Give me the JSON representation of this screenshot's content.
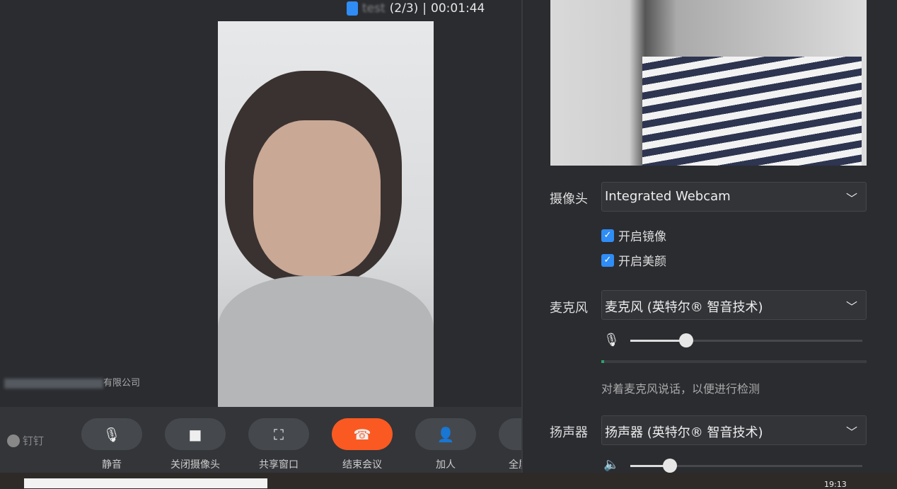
{
  "meeting": {
    "title_blurred": "test",
    "count": "(2/3)",
    "separator": "|",
    "timer": "00:01:44"
  },
  "participant": {
    "company_suffix": "有限公司"
  },
  "brand": {
    "name": "钉钉"
  },
  "toolbar": [
    {
      "label": "静音",
      "icon": "microphone-icon",
      "glyph": "🎙"
    },
    {
      "label": "关闭摄像头",
      "icon": "camera-icon",
      "glyph": "■"
    },
    {
      "label": "共享窗口",
      "icon": "share-window-icon",
      "glyph": "⛶"
    },
    {
      "label": "结束会议",
      "icon": "hang-up-icon",
      "glyph": "☎"
    },
    {
      "label": "加人",
      "icon": "add-person-icon",
      "glyph": "👤"
    },
    {
      "label": "全屏",
      "icon": "fullscreen-icon",
      "glyph": "⤢"
    }
  ],
  "settings": {
    "camera_label": "摄像头",
    "camera_value": "Integrated Webcam",
    "mirror_label": "开启镜像",
    "mirror_checked": true,
    "beauty_label": "开启美颜",
    "beauty_checked": true,
    "mic_label": "麦克风",
    "mic_value": "麦克风 (英特尔® 智音技术)",
    "mic_volume_percent": 24,
    "mic_level_percent": 1,
    "mic_hint": "对着麦克风说话，以便进行检测",
    "speaker_label": "扬声器",
    "speaker_value": "扬声器 (英特尔® 智音技术)",
    "speaker_volume_percent": 17,
    "accent": "#2f8df5",
    "end_color": "#fa5a22"
  },
  "taskbar": {
    "time": "19:13"
  }
}
